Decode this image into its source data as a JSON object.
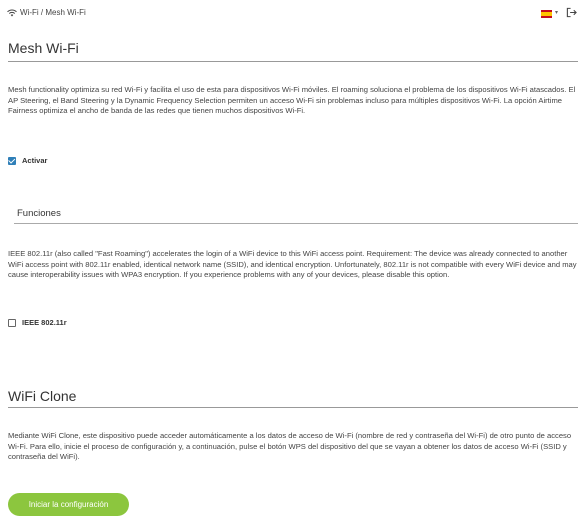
{
  "breadcrumb": {
    "icon": "wifi-icon",
    "text": "Wi-Fi / Mesh Wi-Fi"
  },
  "header": {
    "language_flag": "spain-flag-icon",
    "language_caret": "▾",
    "logout_icon": "logout-icon"
  },
  "mesh": {
    "title": "Mesh Wi-Fi",
    "description": "Mesh functionality optimiza su red Wi-Fi y facilita el uso de esta para dispositivos Wi-Fi móviles. El roaming soluciona el problema de los dispositivos Wi-Fi atascados. El AP Steering, el Band Steering y la Dynamic Frequency Selection permiten un acceso Wi-Fi sin problemas incluso para múltiples dispositivos Wi-Fi. La opción Airtime Fairness optimiza el ancho de banda de las redes que tienen muchos dispositivos Wi-Fi.",
    "activate_label": "Activar",
    "activate_checked": true
  },
  "funciones": {
    "title": "Funciones",
    "description": "IEEE 802.11r (also called \"Fast Roaming\") accelerates the login of a WiFi device to this WiFi access point. Requirement: The device was already connected to another WiFi access point with 802.11r enabled, identical network name (SSID), and identical encryption. Unfortunately, 802.11r is not compatible with every WiFi device and may cause interoperability issues with WPA3 encryption. If you experience problems with any of your devices, please disable this option.",
    "ieee_label": "IEEE 802.11r",
    "ieee_checked": false
  },
  "clone": {
    "title": "WiFi Clone",
    "description": "Mediante WiFi Clone, este dispositivo puede acceder automáticamente a los datos de acceso de Wi-Fi (nombre de red y contraseña del Wi-Fi) de otro punto de acceso Wi-Fi. Para ello, inicie el proceso de configuración y, a continuación, pulse el botón WPS del dispositivo del que se vayan a obtener los datos de acceso Wi-Fi (SSID y contraseña del WiFi).",
    "button_label": "Iniciar la configuración"
  },
  "colors": {
    "accent_green": "#8cc63e",
    "checkbox_blue": "#2f7fb8"
  }
}
